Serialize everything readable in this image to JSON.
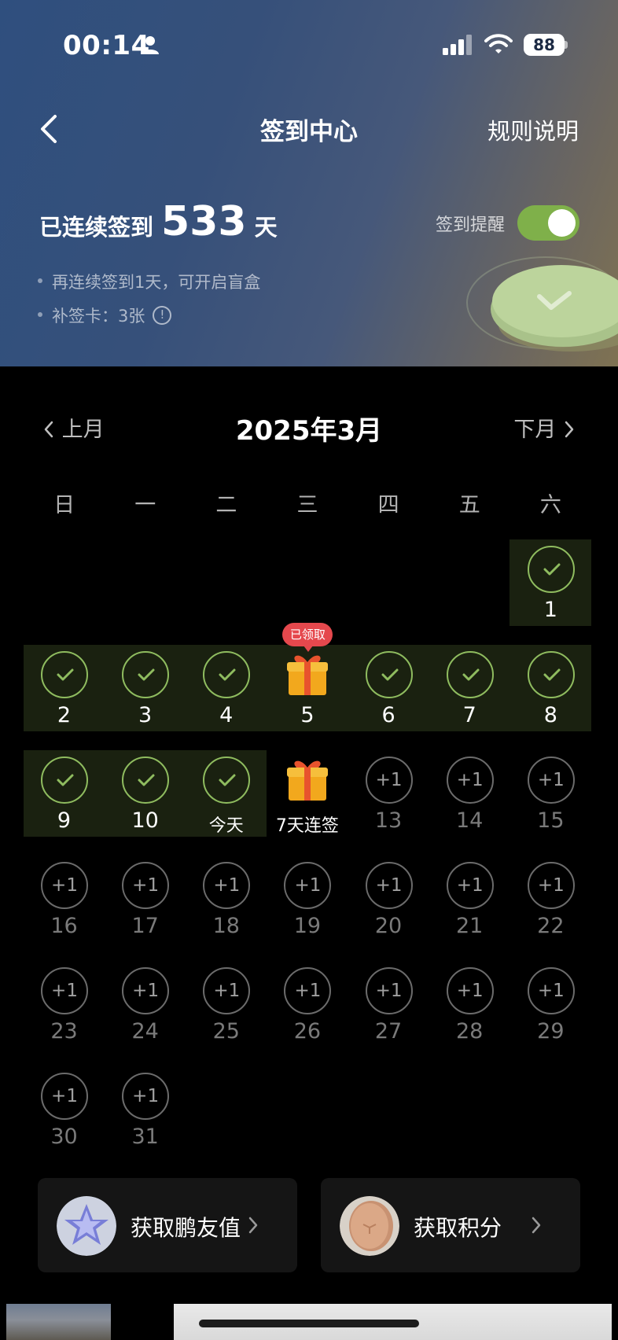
{
  "status_bar": {
    "time": "00:14",
    "battery": "88"
  },
  "nav": {
    "title": "签到中心",
    "rules_link": "规则说明"
  },
  "streak": {
    "prefix": "已连续签到",
    "days": "533",
    "suffix": "天"
  },
  "info": {
    "line1": "再连续签到1天，可开启盲盒",
    "line2": "补签卡：3张"
  },
  "reminder": {
    "label": "签到提醒",
    "enabled": true
  },
  "calendar": {
    "prev_label": "上月",
    "next_label": "下月",
    "month_title": "2025年3月",
    "weekdays": [
      "日",
      "一",
      "二",
      "三",
      "四",
      "五",
      "六"
    ],
    "plus_label": "+1",
    "claimed_badge": "已领取",
    "streak_reward_label": "7天连签",
    "days": [
      {
        "label": "1",
        "state": "done"
      },
      {
        "label": "2",
        "state": "done"
      },
      {
        "label": "3",
        "state": "done"
      },
      {
        "label": "4",
        "state": "done"
      },
      {
        "label": "5",
        "state": "gift-claimed"
      },
      {
        "label": "6",
        "state": "done"
      },
      {
        "label": "7",
        "state": "done"
      },
      {
        "label": "8",
        "state": "done"
      },
      {
        "label": "9",
        "state": "done"
      },
      {
        "label": "10",
        "state": "done"
      },
      {
        "label": "今天",
        "state": "done"
      },
      {
        "label": "7天连签",
        "state": "gift"
      },
      {
        "label": "13",
        "state": "todo"
      },
      {
        "label": "14",
        "state": "todo"
      },
      {
        "label": "15",
        "state": "todo"
      },
      {
        "label": "16",
        "state": "todo"
      },
      {
        "label": "17",
        "state": "todo"
      },
      {
        "label": "18",
        "state": "todo"
      },
      {
        "label": "19",
        "state": "todo"
      },
      {
        "label": "20",
        "state": "todo"
      },
      {
        "label": "21",
        "state": "todo"
      },
      {
        "label": "22",
        "state": "todo"
      },
      {
        "label": "23",
        "state": "todo"
      },
      {
        "label": "24",
        "state": "todo"
      },
      {
        "label": "25",
        "state": "todo"
      },
      {
        "label": "26",
        "state": "todo"
      },
      {
        "label": "27",
        "state": "todo"
      },
      {
        "label": "28",
        "state": "todo"
      },
      {
        "label": "29",
        "state": "todo"
      },
      {
        "label": "30",
        "state": "todo"
      },
      {
        "label": "31",
        "state": "todo"
      }
    ]
  },
  "cards": [
    {
      "label": "获取鹏友值",
      "icon": "crystal-star-icon"
    },
    {
      "label": "获取积分",
      "icon": "coin-icon"
    }
  ],
  "colors": {
    "checked": "#8fbc5f",
    "toggle_on": "#7fb04a",
    "badge": "#e5484d",
    "band": "#1a2110"
  }
}
